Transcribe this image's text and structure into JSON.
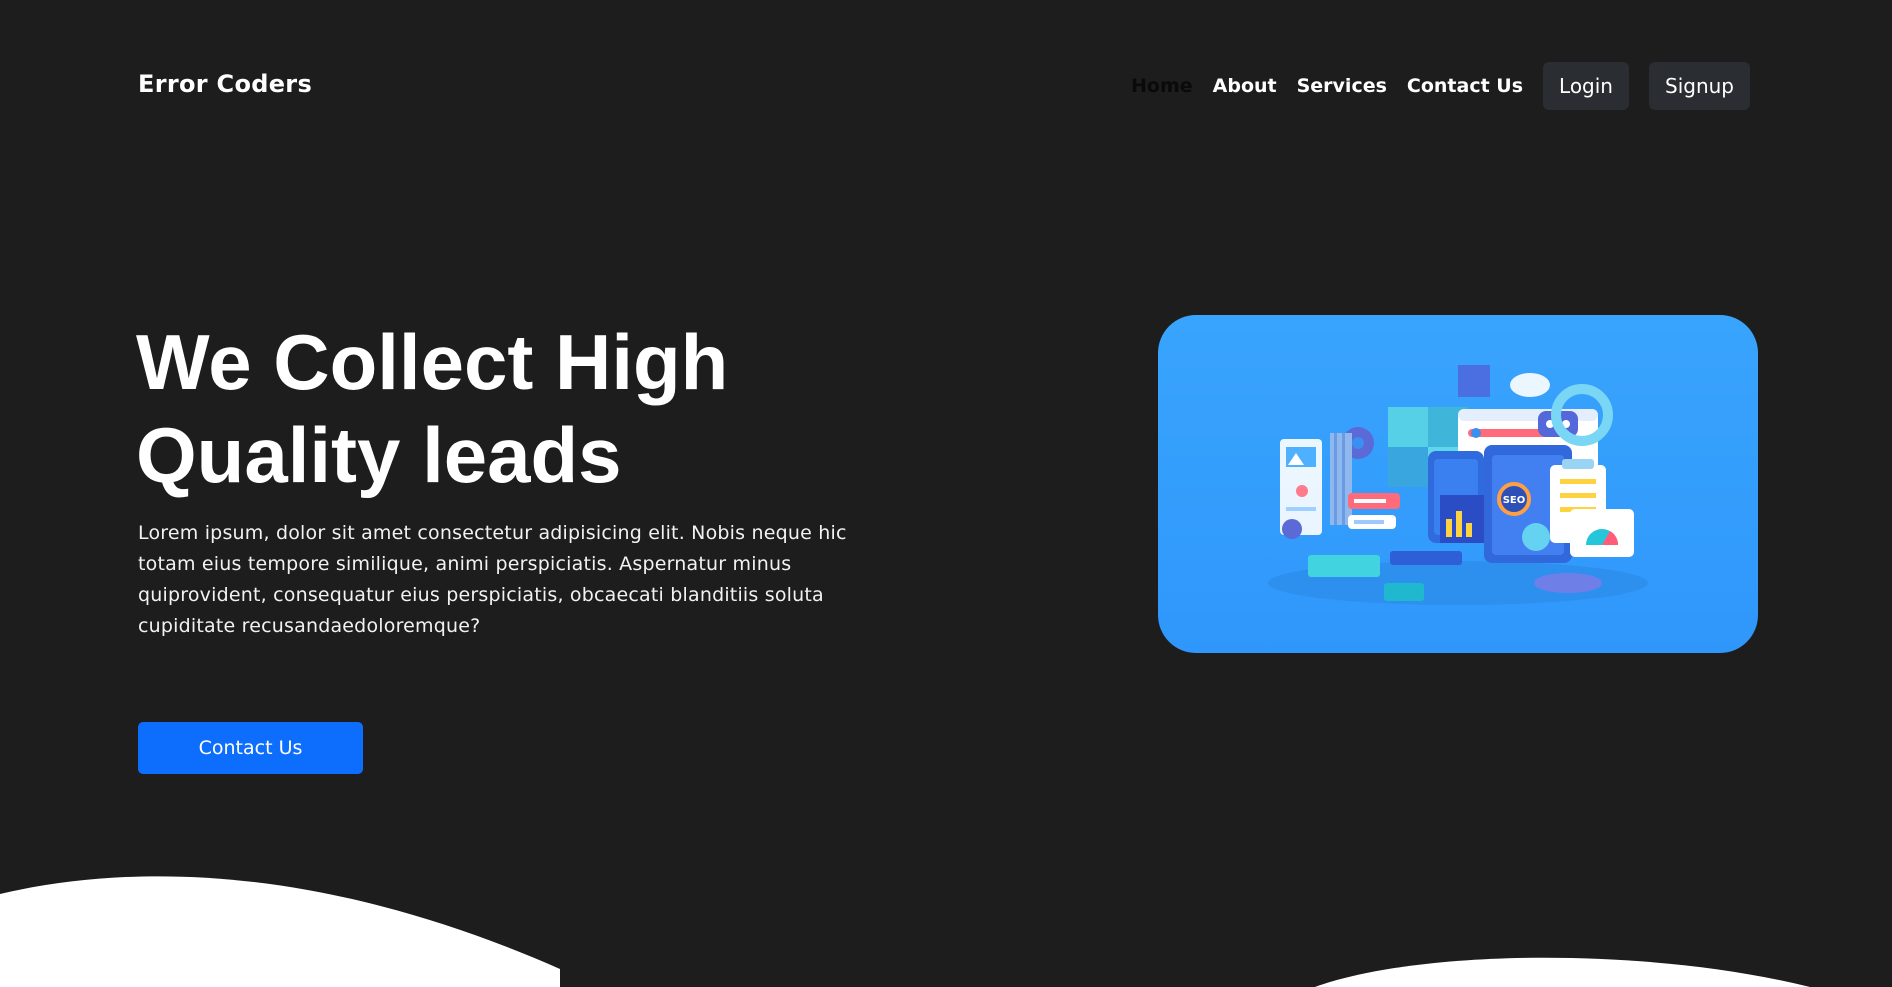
{
  "navbar": {
    "brand": "Error Coders",
    "links": [
      "Home",
      "About",
      "Services",
      "Contact Us"
    ],
    "login_label": "Login",
    "signup_label": "Signup"
  },
  "hero": {
    "title_line1": "We Collect High",
    "title_line2": "Quality leads",
    "text_lines": [
      "Lorem ipsum, dolor sit amet consectetur adipisicing elit. Nobis neque hic",
      "totam eius tempore similique, animi perspiciatis. Aspernatur minus",
      "quiprovident, consequatur eius perspiciatis, obcaecati blanditiis soluta",
      "cupiditate recusandaedoloremque?"
    ],
    "cta_label": "Contact Us",
    "image_badge": "SEO"
  },
  "colors": {
    "background": "#1d1d1e",
    "accent": "#0d6efd",
    "nav_button": "#2a2d31",
    "illustration_bg": "#39a4fd",
    "wave": "#ffffff"
  }
}
